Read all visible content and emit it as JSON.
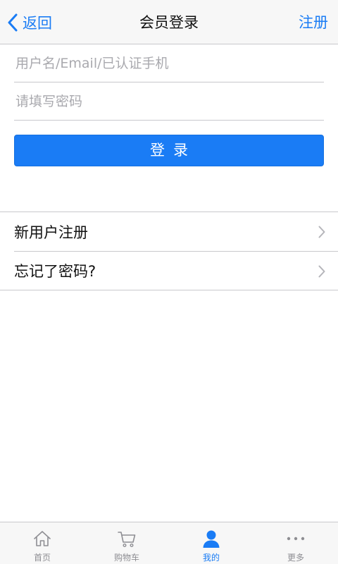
{
  "nav": {
    "back_label": "返回",
    "title": "会员登录",
    "right_label": "注册"
  },
  "form": {
    "username_placeholder": "用户名/Email/已认证手机",
    "username_value": "",
    "password_placeholder": "请填写密码",
    "password_value": "",
    "login_label": "登录"
  },
  "menu": {
    "items": [
      {
        "label": "新用户注册",
        "icon": "chevron-right-icon"
      },
      {
        "label": "忘记了密码?",
        "icon": "chevron-right-icon"
      }
    ]
  },
  "tabbar": {
    "tabs": [
      {
        "label": "首页",
        "icon": "home-icon",
        "active": false
      },
      {
        "label": "购物车",
        "icon": "cart-icon",
        "active": false
      },
      {
        "label": "我的",
        "icon": "user-icon",
        "active": true
      },
      {
        "label": "更多",
        "icon": "more-icon",
        "active": false
      }
    ]
  },
  "colors": {
    "accent": "#1a7cf5",
    "inactive": "#8e8e93",
    "bar_bg": "#f7f7f7",
    "separator": "#c8c8cc"
  }
}
